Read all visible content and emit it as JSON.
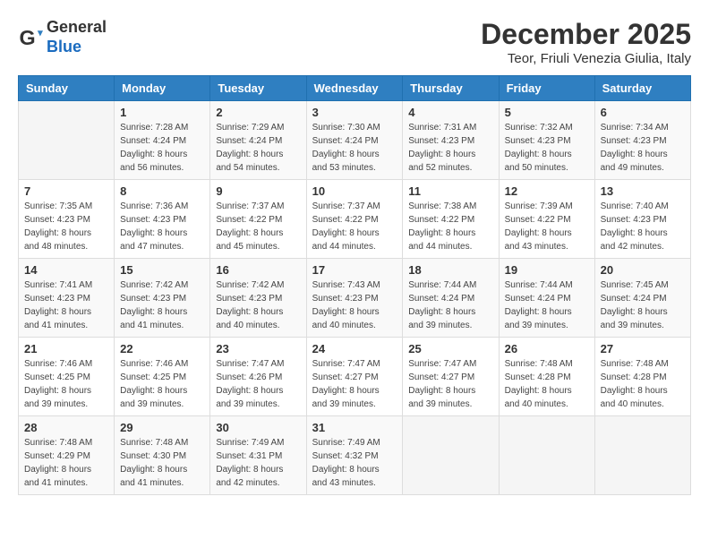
{
  "logo": {
    "general": "General",
    "blue": "Blue"
  },
  "header": {
    "month": "December 2025",
    "location": "Teor, Friuli Venezia Giulia, Italy"
  },
  "weekdays": [
    "Sunday",
    "Monday",
    "Tuesday",
    "Wednesday",
    "Thursday",
    "Friday",
    "Saturday"
  ],
  "weeks": [
    [
      {
        "day": "",
        "info": ""
      },
      {
        "day": "1",
        "info": "Sunrise: 7:28 AM\nSunset: 4:24 PM\nDaylight: 8 hours\nand 56 minutes."
      },
      {
        "day": "2",
        "info": "Sunrise: 7:29 AM\nSunset: 4:24 PM\nDaylight: 8 hours\nand 54 minutes."
      },
      {
        "day": "3",
        "info": "Sunrise: 7:30 AM\nSunset: 4:24 PM\nDaylight: 8 hours\nand 53 minutes."
      },
      {
        "day": "4",
        "info": "Sunrise: 7:31 AM\nSunset: 4:23 PM\nDaylight: 8 hours\nand 52 minutes."
      },
      {
        "day": "5",
        "info": "Sunrise: 7:32 AM\nSunset: 4:23 PM\nDaylight: 8 hours\nand 50 minutes."
      },
      {
        "day": "6",
        "info": "Sunrise: 7:34 AM\nSunset: 4:23 PM\nDaylight: 8 hours\nand 49 minutes."
      }
    ],
    [
      {
        "day": "7",
        "info": "Sunrise: 7:35 AM\nSunset: 4:23 PM\nDaylight: 8 hours\nand 48 minutes."
      },
      {
        "day": "8",
        "info": "Sunrise: 7:36 AM\nSunset: 4:23 PM\nDaylight: 8 hours\nand 47 minutes."
      },
      {
        "day": "9",
        "info": "Sunrise: 7:37 AM\nSunset: 4:22 PM\nDaylight: 8 hours\nand 45 minutes."
      },
      {
        "day": "10",
        "info": "Sunrise: 7:37 AM\nSunset: 4:22 PM\nDaylight: 8 hours\nand 44 minutes."
      },
      {
        "day": "11",
        "info": "Sunrise: 7:38 AM\nSunset: 4:22 PM\nDaylight: 8 hours\nand 44 minutes."
      },
      {
        "day": "12",
        "info": "Sunrise: 7:39 AM\nSunset: 4:22 PM\nDaylight: 8 hours\nand 43 minutes."
      },
      {
        "day": "13",
        "info": "Sunrise: 7:40 AM\nSunset: 4:23 PM\nDaylight: 8 hours\nand 42 minutes."
      }
    ],
    [
      {
        "day": "14",
        "info": "Sunrise: 7:41 AM\nSunset: 4:23 PM\nDaylight: 8 hours\nand 41 minutes."
      },
      {
        "day": "15",
        "info": "Sunrise: 7:42 AM\nSunset: 4:23 PM\nDaylight: 8 hours\nand 41 minutes."
      },
      {
        "day": "16",
        "info": "Sunrise: 7:42 AM\nSunset: 4:23 PM\nDaylight: 8 hours\nand 40 minutes."
      },
      {
        "day": "17",
        "info": "Sunrise: 7:43 AM\nSunset: 4:23 PM\nDaylight: 8 hours\nand 40 minutes."
      },
      {
        "day": "18",
        "info": "Sunrise: 7:44 AM\nSunset: 4:24 PM\nDaylight: 8 hours\nand 39 minutes."
      },
      {
        "day": "19",
        "info": "Sunrise: 7:44 AM\nSunset: 4:24 PM\nDaylight: 8 hours\nand 39 minutes."
      },
      {
        "day": "20",
        "info": "Sunrise: 7:45 AM\nSunset: 4:24 PM\nDaylight: 8 hours\nand 39 minutes."
      }
    ],
    [
      {
        "day": "21",
        "info": "Sunrise: 7:46 AM\nSunset: 4:25 PM\nDaylight: 8 hours\nand 39 minutes."
      },
      {
        "day": "22",
        "info": "Sunrise: 7:46 AM\nSunset: 4:25 PM\nDaylight: 8 hours\nand 39 minutes."
      },
      {
        "day": "23",
        "info": "Sunrise: 7:47 AM\nSunset: 4:26 PM\nDaylight: 8 hours\nand 39 minutes."
      },
      {
        "day": "24",
        "info": "Sunrise: 7:47 AM\nSunset: 4:27 PM\nDaylight: 8 hours\nand 39 minutes."
      },
      {
        "day": "25",
        "info": "Sunrise: 7:47 AM\nSunset: 4:27 PM\nDaylight: 8 hours\nand 39 minutes."
      },
      {
        "day": "26",
        "info": "Sunrise: 7:48 AM\nSunset: 4:28 PM\nDaylight: 8 hours\nand 40 minutes."
      },
      {
        "day": "27",
        "info": "Sunrise: 7:48 AM\nSunset: 4:28 PM\nDaylight: 8 hours\nand 40 minutes."
      }
    ],
    [
      {
        "day": "28",
        "info": "Sunrise: 7:48 AM\nSunset: 4:29 PM\nDaylight: 8 hours\nand 41 minutes."
      },
      {
        "day": "29",
        "info": "Sunrise: 7:48 AM\nSunset: 4:30 PM\nDaylight: 8 hours\nand 41 minutes."
      },
      {
        "day": "30",
        "info": "Sunrise: 7:49 AM\nSunset: 4:31 PM\nDaylight: 8 hours\nand 42 minutes."
      },
      {
        "day": "31",
        "info": "Sunrise: 7:49 AM\nSunset: 4:32 PM\nDaylight: 8 hours\nand 43 minutes."
      },
      {
        "day": "",
        "info": ""
      },
      {
        "day": "",
        "info": ""
      },
      {
        "day": "",
        "info": ""
      }
    ]
  ]
}
